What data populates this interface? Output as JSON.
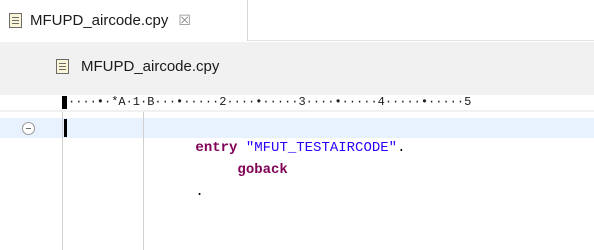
{
  "tab": {
    "title": "MFUPD_aircode.cpy",
    "close_glyph": "☒",
    "icon": "copybook-file-icon"
  },
  "breadcrumb": {
    "label": "MFUPD_aircode.cpy",
    "icon": "copybook-file-icon"
  },
  "ruler": {
    "text": "····•·*A·1·B···•·····2····•·····3····•·····4·····•·····5"
  },
  "code": {
    "line1": {
      "keyword": "entry",
      "space": " ",
      "string": "\"MFUT_TESTAIRCODE\"",
      "tail": "."
    },
    "line2": {
      "keyword": "goback"
    },
    "line3": {
      "text": "."
    }
  },
  "colors": {
    "keyword": "#7f0055",
    "string": "#2a00ff",
    "current_line": "#e8f2fe",
    "editor_bg": "#f1f1f1"
  }
}
